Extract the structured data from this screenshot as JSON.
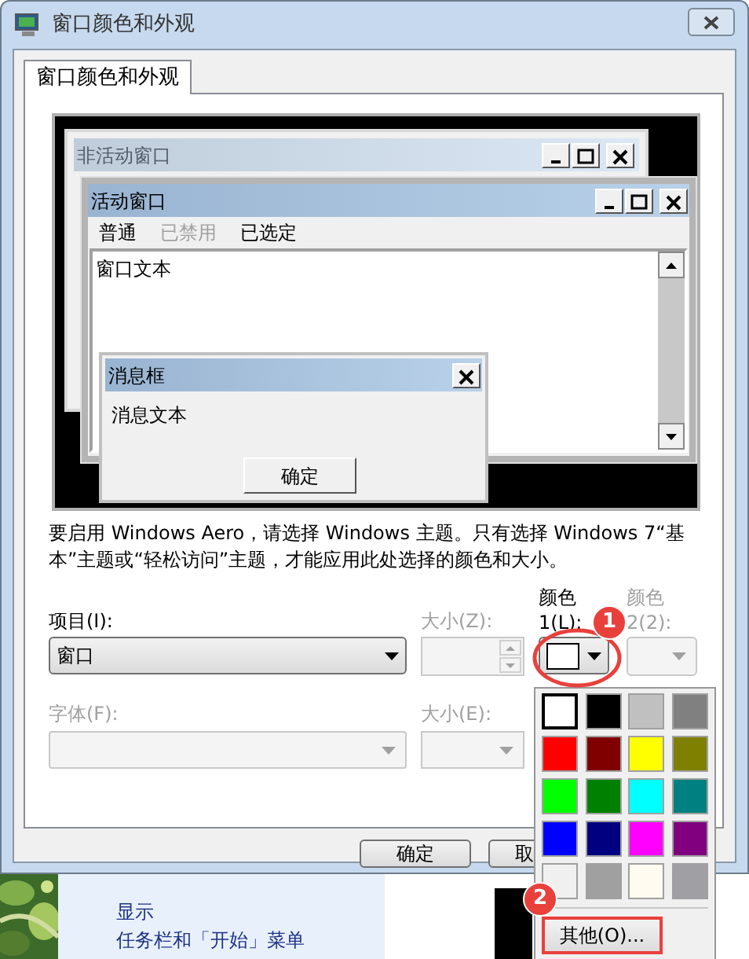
{
  "window": {
    "title": "窗口颜色和外观"
  },
  "tabs": [
    {
      "label": "窗口颜色和外观",
      "selected": true
    }
  ],
  "preview": {
    "inactive_window": {
      "title": "非活动窗口"
    },
    "active_window": {
      "title": "活动窗口",
      "menu": [
        {
          "label": "普通",
          "disabled": false
        },
        {
          "label": "已禁用",
          "disabled": true
        },
        {
          "label": "已选定",
          "disabled": false
        }
      ],
      "text": "窗口文本"
    },
    "message_box": {
      "title": "消息框",
      "text": "消息文本",
      "button": "确定"
    }
  },
  "description": "要启用 Windows Aero，请选择 Windows 主题。只有选择 Windows 7“基本”主题或“轻松访问”主题，才能应用此处选择的颜色和大小。",
  "fields": {
    "item": {
      "label": "项目(I):",
      "value": "窗口",
      "disabled": false
    },
    "item_size": {
      "label": "大小(Z):",
      "disabled": true
    },
    "color1": {
      "label": "颜色\n1(L):",
      "color": "#ffffff",
      "disabled": false
    },
    "color2": {
      "label": "颜色\n2(2):",
      "disabled": true
    },
    "font": {
      "label": "字体(F):",
      "disabled": true
    },
    "font_size": {
      "label": "大小(E):",
      "disabled": true
    }
  },
  "buttons": [
    "确定",
    "取"
  ],
  "color_menu": {
    "swatches": [
      {
        "color": "#ffffff",
        "selected": true
      },
      {
        "color": "#000000",
        "selected": false
      },
      {
        "color": "#c0c0c0",
        "selected": false
      },
      {
        "color": "#808080",
        "selected": false
      },
      {
        "color": "#ff0000",
        "selected": false
      },
      {
        "color": "#800000",
        "selected": false
      },
      {
        "color": "#ffff00",
        "selected": false
      },
      {
        "color": "#808000",
        "selected": false
      },
      {
        "color": "#00ff00",
        "selected": false
      },
      {
        "color": "#008000",
        "selected": false
      },
      {
        "color": "#00ffff",
        "selected": false
      },
      {
        "color": "#008080",
        "selected": false
      },
      {
        "color": "#0000ff",
        "selected": false
      },
      {
        "color": "#000080",
        "selected": false
      },
      {
        "color": "#ff00ff",
        "selected": false
      },
      {
        "color": "#800080",
        "selected": false
      },
      {
        "color": "#f0f0f0",
        "selected": false
      },
      {
        "color": "#a0a0a0",
        "selected": false
      },
      {
        "color": "#fffbf0",
        "selected": false
      },
      {
        "color": "#a0a0a4",
        "selected": false
      }
    ],
    "other_button": "其他(O)..."
  },
  "callouts": [
    "1",
    "2"
  ],
  "desktop": {
    "items": [
      "显示",
      "任务栏和「开始」菜单"
    ]
  }
}
